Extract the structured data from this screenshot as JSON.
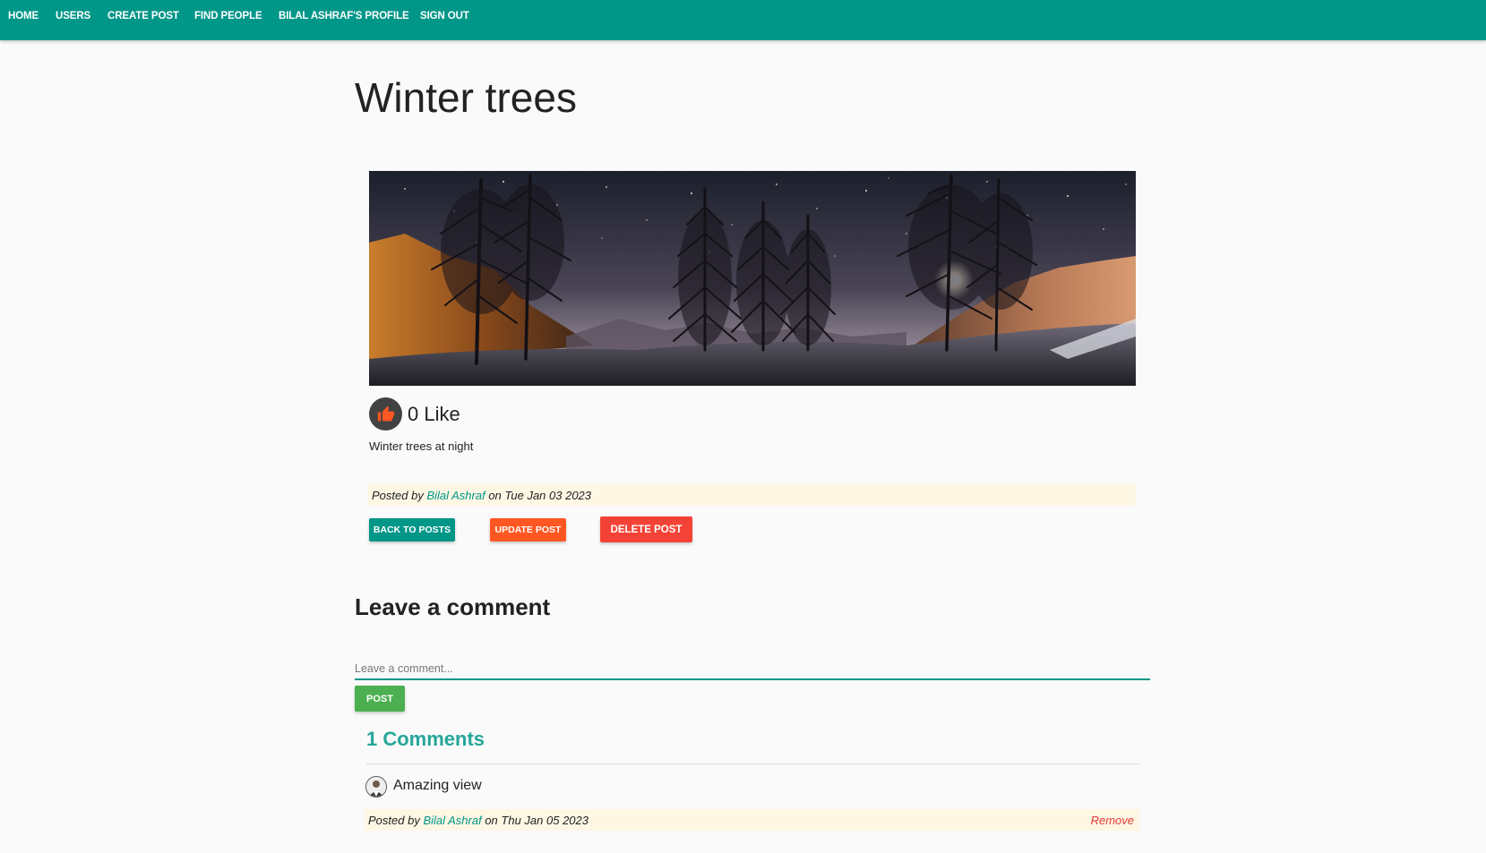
{
  "nav": {
    "items": [
      {
        "label": "HOME"
      },
      {
        "label": "USERS"
      },
      {
        "label": "CREATE POST"
      },
      {
        "label": "FIND PEOPLE"
      },
      {
        "label": "BILAL ASHRAF'S PROFILE"
      },
      {
        "label": "SIGN OUT"
      }
    ]
  },
  "post": {
    "title": "Winter trees",
    "likes_text": "0 Like",
    "body": "Winter trees at night",
    "meta": {
      "prefix": "Posted by ",
      "author": "Bilal Ashraf",
      "middle": " on ",
      "date": "Tue Jan 03 2023"
    },
    "buttons": {
      "back": "BACK TO POSTS",
      "update": "UPDATE POST",
      "delete": "DELETE POST"
    }
  },
  "comment_form": {
    "title": "Leave a comment",
    "placeholder": "Leave a comment...",
    "submit": "POST"
  },
  "comments": {
    "count_text": "1 Comments",
    "items": [
      {
        "text": "Amazing view",
        "prefix": "Posted by ",
        "author": "Bilal Ashraf",
        "middle": " on ",
        "date": "Thu Jan 05 2023",
        "remove": "Remove"
      }
    ]
  },
  "colors": {
    "navbar": "#009688",
    "accent_teal": "#26a69a",
    "update_button": "#ff5722",
    "delete_button": "#f44336",
    "post_button": "#4caf50",
    "meta_background": "#fdf7e4"
  },
  "icons": {
    "like": "thumbs-up-icon",
    "avatar": "user-avatar"
  }
}
